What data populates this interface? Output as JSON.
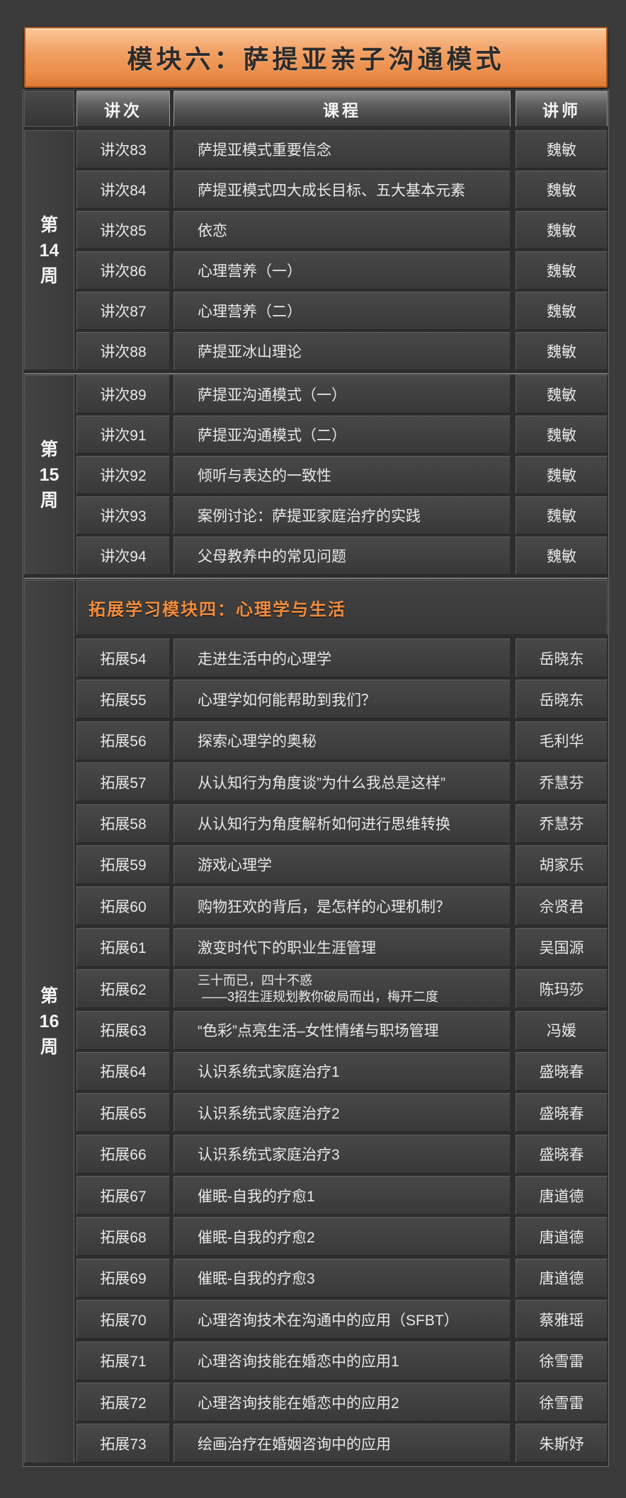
{
  "title": "模块六：萨提亚亲子沟通模式",
  "header": {
    "lecture": "讲次",
    "course": "课程",
    "teacher": "讲师"
  },
  "sections": [
    {
      "week": [
        "第",
        "14",
        "周"
      ],
      "rows": [
        {
          "lecture": "讲次83",
          "course": "萨提亚模式重要信念",
          "teacher": "魏敏"
        },
        {
          "lecture": "讲次84",
          "course": "萨提亚模式四大成长目标、五大基本元素",
          "teacher": "魏敏"
        },
        {
          "lecture": "讲次85",
          "course": "依恋",
          "teacher": "魏敏"
        },
        {
          "lecture": "讲次86",
          "course": "心理营养（一）",
          "teacher": "魏敏"
        },
        {
          "lecture": "讲次87",
          "course": "心理营养（二）",
          "teacher": "魏敏"
        },
        {
          "lecture": "讲次88",
          "course": "萨提亚冰山理论",
          "teacher": "魏敏"
        }
      ]
    },
    {
      "week": [
        "第",
        "15",
        "周"
      ],
      "rows": [
        {
          "lecture": "讲次89",
          "course": "萨提亚沟通模式（一）",
          "teacher": "魏敏"
        },
        {
          "lecture": "讲次91",
          "course": "萨提亚沟通模式（二）",
          "teacher": "魏敏"
        },
        {
          "lecture": "讲次92",
          "course": "倾听与表达的一致性",
          "teacher": "魏敏"
        },
        {
          "lecture": "讲次93",
          "course": "案例讨论：萨提亚家庭治疗的实践",
          "teacher": "魏敏"
        },
        {
          "lecture": "讲次94",
          "course": "父母教养中的常见问题",
          "teacher": "魏敏"
        }
      ]
    },
    {
      "week": [
        "第",
        "16",
        "周"
      ],
      "banner": "拓展学习模块四：心理学与生活",
      "rows": [
        {
          "lecture": "拓展54",
          "course": "走进生活中的心理学",
          "teacher": "岳晓东"
        },
        {
          "lecture": "拓展55",
          "course": "心理学如何能帮助到我们？",
          "teacher": "岳晓东"
        },
        {
          "lecture": "拓展56",
          "course": "探索心理学的奥秘",
          "teacher": "毛利华"
        },
        {
          "lecture": "拓展57",
          "course": "从认知行为角度谈”为什么我总是这样”",
          "teacher": "乔慧芬"
        },
        {
          "lecture": "拓展58",
          "course": "从认知行为角度解析如何进行思维转换",
          "teacher": "乔慧芬"
        },
        {
          "lecture": "拓展59",
          "course": "游戏心理学",
          "teacher": "胡家乐"
        },
        {
          "lecture": "拓展60",
          "course": "购物狂欢的背后，是怎样的心理机制？",
          "teacher": "佘贤君"
        },
        {
          "lecture": "拓展61",
          "course": "激变时代下的职业生涯管理",
          "teacher": "吴国源"
        },
        {
          "lecture": "拓展62",
          "course": "三十而已，四十不惑",
          "course_sub": "——3招生涯规划教你破局而出，梅开二度",
          "teacher": "陈玛莎"
        },
        {
          "lecture": "拓展63",
          "course": "“色彩”点亮生活–女性情绪与职场管理",
          "teacher": "冯媛"
        },
        {
          "lecture": "拓展64",
          "course": "认识系统式家庭治疗1",
          "teacher": "盛晓春"
        },
        {
          "lecture": "拓展65",
          "course": "认识系统式家庭治疗2",
          "teacher": "盛晓春"
        },
        {
          "lecture": "拓展66",
          "course": "认识系统式家庭治疗3",
          "teacher": "盛晓春"
        },
        {
          "lecture": "拓展67",
          "course": "催眠-自我的疗愈1",
          "teacher": "唐道德"
        },
        {
          "lecture": "拓展68",
          "course": "催眠-自我的疗愈2",
          "teacher": "唐道德"
        },
        {
          "lecture": "拓展69",
          "course": "催眠-自我的疗愈3",
          "teacher": "唐道德"
        },
        {
          "lecture": "拓展70",
          "course": "心理咨询技术在沟通中的应用（SFBT）",
          "teacher": "蔡雅瑶"
        },
        {
          "lecture": "拓展71",
          "course": "心理咨询技能在婚恋中的应用1",
          "teacher": "徐雪雷"
        },
        {
          "lecture": "拓展72",
          "course": "心理咨询技能在婚恋中的应用2",
          "teacher": "徐雪雷"
        },
        {
          "lecture": "拓展73",
          "course": "绘画治疗在婚姻咨询中的应用",
          "teacher": "朱斯妤"
        }
      ]
    }
  ],
  "colors": {
    "background": "#3b3b3b",
    "title_banner": "#f2a064",
    "module_heading_text": "#f28d3e",
    "text": "#e8e8e8"
  }
}
